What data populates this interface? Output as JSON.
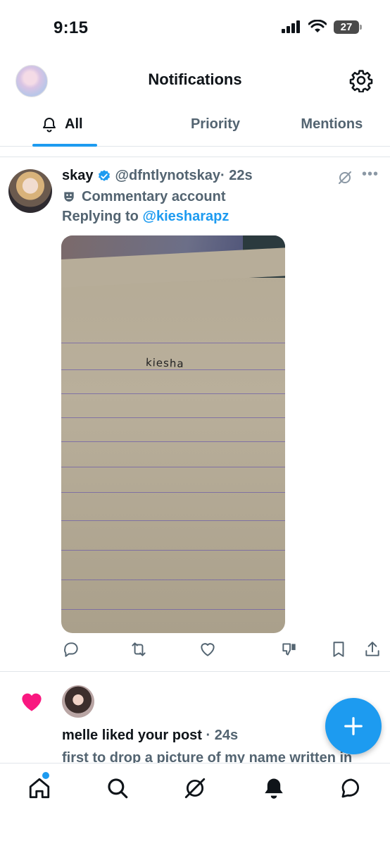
{
  "status_bar": {
    "time": "9:15",
    "battery": "27"
  },
  "header": {
    "title": "Notifications"
  },
  "tabs": [
    {
      "label": "All"
    },
    {
      "label": "Priority"
    },
    {
      "label": "Mentions"
    }
  ],
  "tweet": {
    "name": "skay",
    "handle": "@dfntlynotskay",
    "time": "· 22s",
    "label": "Commentary account",
    "replying_prefix": "Replying to",
    "replying_to": "@kiesharapz",
    "photo_text": "kiesha"
  },
  "like_notification": {
    "text": "melle liked your post",
    "time": "· 24s",
    "preview": "first to drop a picture of my name written in"
  },
  "colors": {
    "accent": "#1d9bf0",
    "like": "#f91880",
    "secondary_text": "#536471"
  }
}
